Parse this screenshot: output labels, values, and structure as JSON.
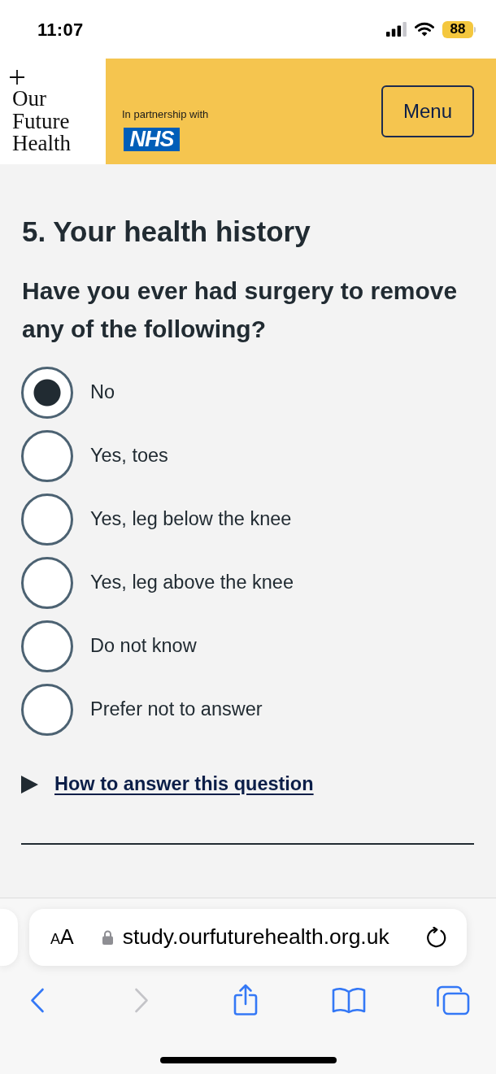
{
  "status_bar": {
    "time": "11:07",
    "battery": "88"
  },
  "header": {
    "logo_text": "Our Future Health",
    "partnership_text": "In partnership with",
    "partner_logo": "NHS",
    "menu_button": "Menu"
  },
  "form": {
    "section_title": "5. Your health history",
    "question": "Have you ever had surgery to remove any of the following?",
    "options": [
      {
        "label": "No",
        "selected": true
      },
      {
        "label": "Yes, toes",
        "selected": false
      },
      {
        "label": "Yes, leg below the knee",
        "selected": false
      },
      {
        "label": "Yes, leg above the knee",
        "selected": false
      },
      {
        "label": "Do not know",
        "selected": false
      },
      {
        "label": "Prefer not to answer",
        "selected": false
      }
    ],
    "help": {
      "label": "How to answer this question",
      "expanded": false
    }
  },
  "browser": {
    "text_size_button": "AA",
    "url": "study.ourfuturehealth.org.uk",
    "toolbar": [
      {
        "kind": "back",
        "disabled": false
      },
      {
        "kind": "forward",
        "disabled": true
      },
      {
        "kind": "share",
        "disabled": false
      },
      {
        "kind": "bookmarks",
        "disabled": false
      },
      {
        "kind": "tabs",
        "disabled": false
      }
    ]
  }
}
